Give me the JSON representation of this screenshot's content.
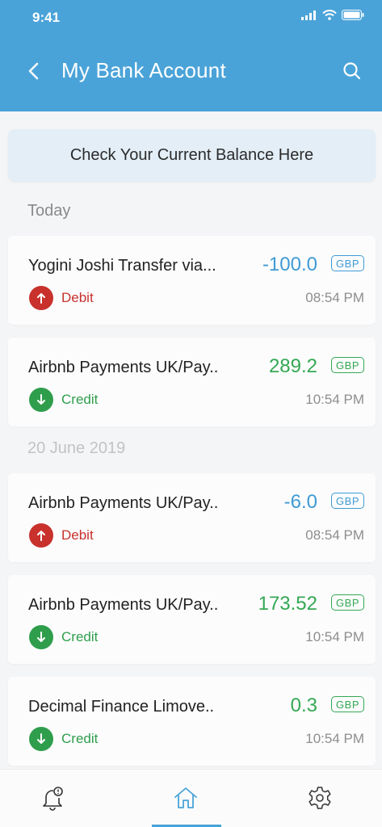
{
  "status_bar": {
    "time": "9:41"
  },
  "header": {
    "title": "My Bank Account"
  },
  "balance_button": {
    "label": "Check Your Current Balance Here"
  },
  "sections": [
    {
      "label": "Today"
    },
    {
      "label": "20 June 2019"
    }
  ],
  "transactions": [
    {
      "name": "Yogini Joshi Transfer via...",
      "amount": "-100.0",
      "currency": "GBP",
      "type": "Debit",
      "time": "08:54 PM"
    },
    {
      "name": "Airbnb Payments UK/Pay..",
      "amount": "289.2",
      "currency": "GBP",
      "type": "Credit",
      "time": "10:54 PM"
    },
    {
      "name": "Airbnb Payments UK/Pay..",
      "amount": "-6.0",
      "currency": "GBP",
      "type": "Debit",
      "time": "08:54 PM"
    },
    {
      "name": "Airbnb Payments UK/Pay..",
      "amount": "173.52",
      "currency": "GBP",
      "type": "Credit",
      "time": "10:54 PM"
    },
    {
      "name": "Decimal Finance Limove..",
      "amount": "0.3",
      "currency": "GBP",
      "type": "Credit",
      "time": "10:54 PM"
    }
  ],
  "tabs": [
    {
      "icon": "bell-alert-icon"
    },
    {
      "icon": "home-icon",
      "active": true
    },
    {
      "icon": "gear-icon"
    }
  ],
  "colors": {
    "header": "#4aa3d8",
    "debit_amount": "#3f9ad3",
    "credit_amount": "#34a853",
    "debit": "#c8312c",
    "credit": "#2f9e4c"
  }
}
